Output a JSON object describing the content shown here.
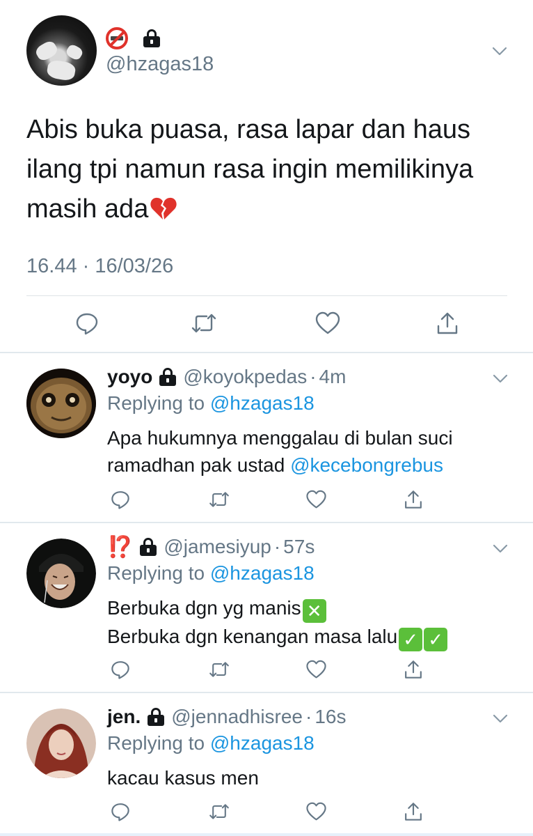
{
  "main_tweet": {
    "handle": "@hzagas18",
    "text": "Abis buka puasa, rasa lapar dan haus ilang tpi namun rasa ingin memilikinya masih ada",
    "timestamp": "16.44 · 16/03/26",
    "badges": [
      "no-smoking-icon",
      "lock-icon"
    ],
    "emoji": "broken-heart-icon",
    "actions": [
      "reply-icon",
      "retweet-icon",
      "like-icon",
      "share-icon"
    ]
  },
  "replies": [
    {
      "name": "yoyo",
      "handle": "@koyokpedas",
      "time": "4m",
      "replying_label": "Replying to",
      "replying_to": "@hzagas18",
      "text_parts": [
        "Apa hukumnya menggalau di bulan suci ramadhan pak ustad ",
        "@kecebongrebus"
      ]
    },
    {
      "name": "⁉️",
      "handle": "@jamesiyup",
      "time": "57s",
      "replying_label": "Replying to",
      "replying_to": "@hzagas18",
      "line1": "Berbuka dgn yg manis",
      "line2": "Berbuka dgn kenangan masa lalu"
    },
    {
      "name": "jen.",
      "handle": "@jennadhisree",
      "time": "16s",
      "replying_label": "Replying to",
      "replying_to": "@hzagas18",
      "text": "kacau kasus men"
    }
  ],
  "separator": "·",
  "colors": {
    "text": "#14171a",
    "secondary": "#657786",
    "link": "#1b95e0",
    "divider": "#e1e8ed",
    "check_green": "#5bbf3a",
    "heart_red": "#e0322b"
  }
}
